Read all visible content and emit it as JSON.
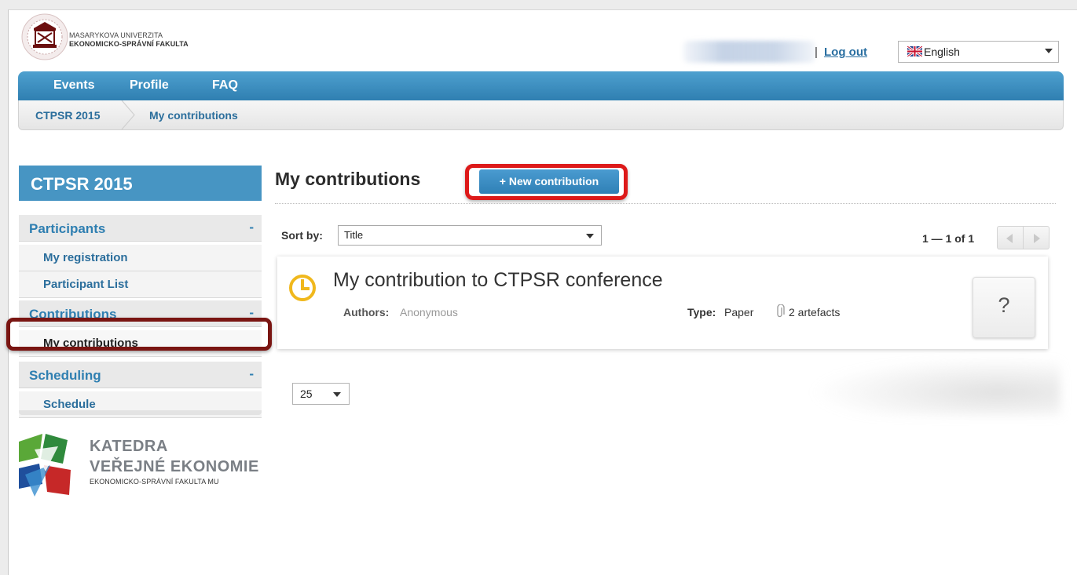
{
  "header": {
    "university_line1": "MASARYKOVA UNIVERZITA",
    "university_line2": "EKONOMICKO-SPRÁVNÍ FAKULTA",
    "separator": "|",
    "logout_label": "Log out",
    "language": "English"
  },
  "nav": {
    "items": [
      {
        "label": "Events"
      },
      {
        "label": "Profile"
      },
      {
        "label": "FAQ"
      }
    ]
  },
  "breadcrumb": {
    "items": [
      {
        "label": "CTPSR 2015"
      },
      {
        "label": "My contributions"
      }
    ]
  },
  "sidebar": {
    "title": "CTPSR 2015",
    "sections": [
      {
        "label": "Participants",
        "toggle": "-",
        "links": [
          {
            "label": "My registration"
          },
          {
            "label": "Participant List"
          }
        ]
      },
      {
        "label": "Contributions",
        "toggle": "-",
        "links": [
          {
            "label": "My contributions",
            "active": true
          }
        ]
      },
      {
        "label": "Scheduling",
        "toggle": "-",
        "links": [
          {
            "label": "Schedule"
          }
        ]
      }
    ]
  },
  "department": {
    "line1": "KATEDRA",
    "line2": "VEŘEJNÉ EKONOMIE",
    "line3": "EKONOMICKO-SPRÁVNÍ FAKULTA MU"
  },
  "main": {
    "title": "My contributions",
    "new_button": "+ New contribution",
    "sort_label": "Sort by:",
    "sort_value": "Title",
    "pager_text": "1 — 1 of 1",
    "per_page": "25"
  },
  "contribution": {
    "title": "My contribution to CTPSR conference",
    "authors_label": "Authors:",
    "authors_value": "Anonymous",
    "type_label": "Type:",
    "type_value": "Paper",
    "artefacts": "2 artefacts",
    "status_button": "?"
  },
  "colors": {
    "accent": "#2f7fb1",
    "nav_bar": "#3d90c3",
    "highlight_red": "#dd1a1a",
    "highlight_dark_red": "#7a1512",
    "clock_yellow": "#f0b81d"
  }
}
